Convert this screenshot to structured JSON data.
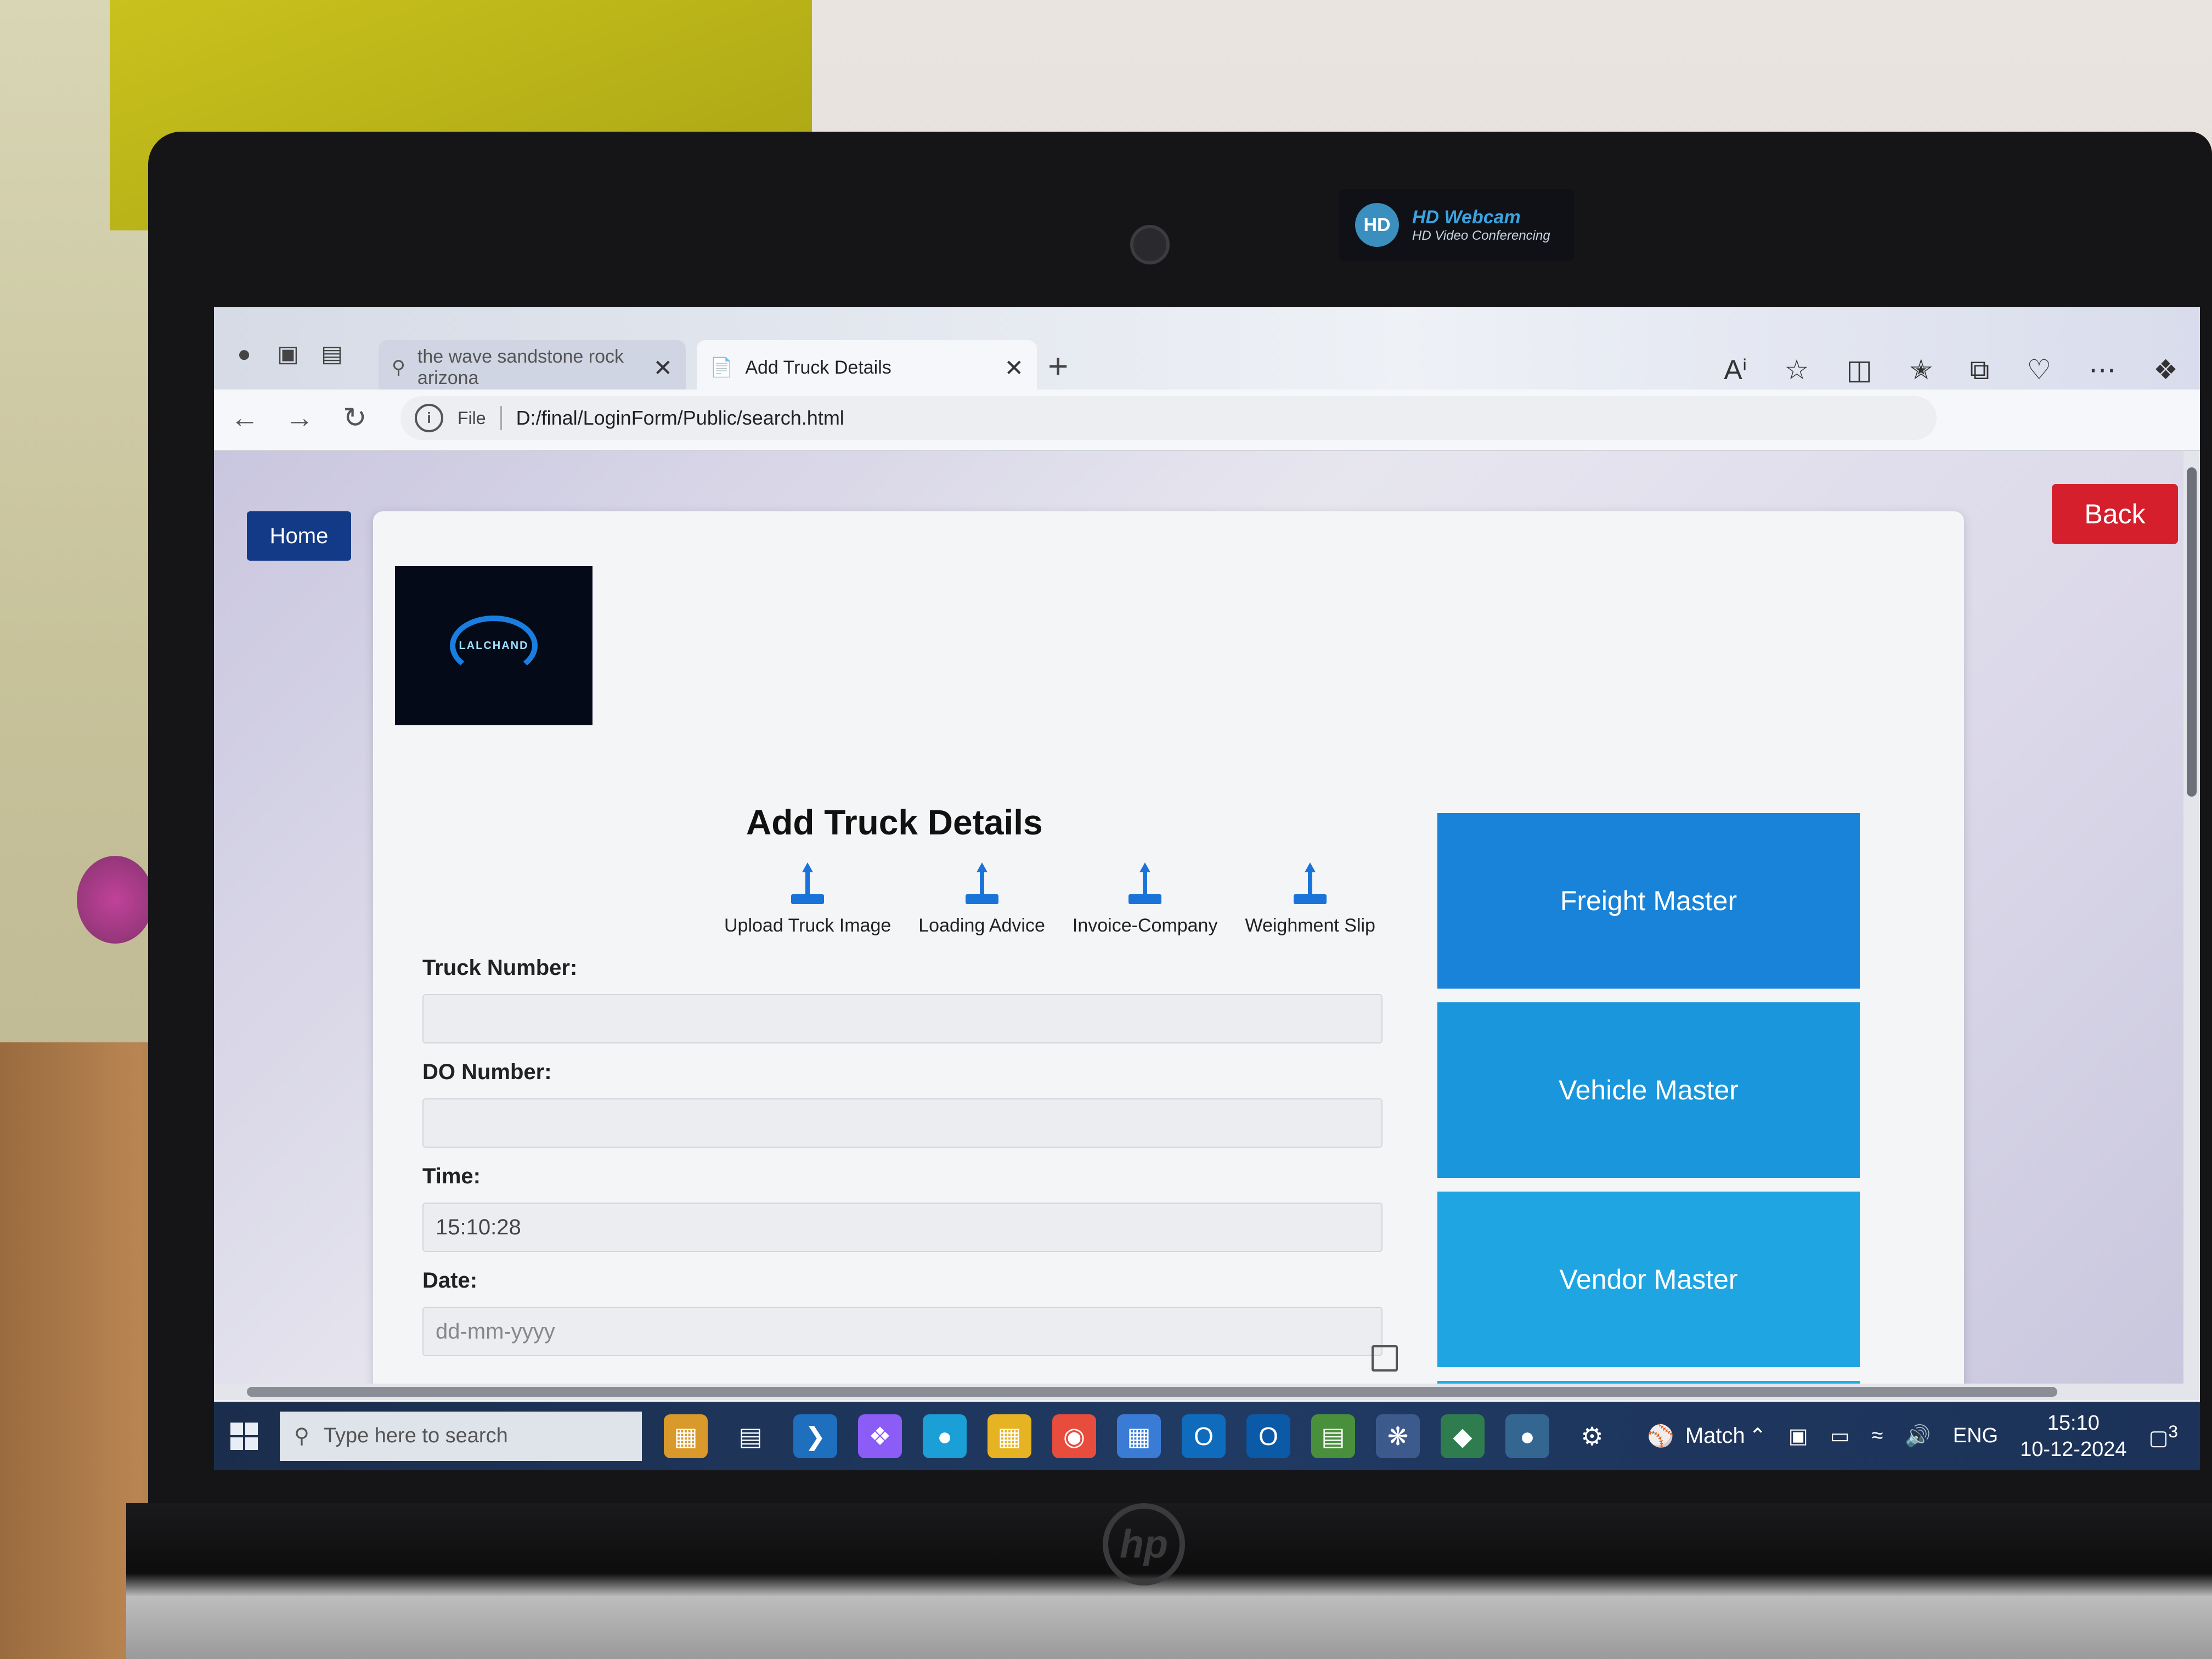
{
  "webcam": {
    "title": "HD Webcam",
    "subtitle": "HD Video Conferencing",
    "badge": "HD"
  },
  "brand": {
    "laptop_logo": "hp"
  },
  "browser": {
    "tabs": [
      {
        "label": "the wave sandstone rock arizona",
        "active": false
      },
      {
        "label": "Add Truck Details",
        "active": true
      }
    ],
    "address": {
      "scheme_label": "File",
      "url": "D:/final/LoginForm/Public/search.html"
    }
  },
  "page": {
    "home_label": "Home",
    "back_label": "Back",
    "logo_text": "LALCHAND",
    "form_title": "Add Truck Details",
    "uploads": [
      "Upload Truck Image",
      "Loading Advice",
      "Invoice-Company",
      "Weighment Slip"
    ],
    "fields": {
      "truck_number": {
        "label": "Truck Number:",
        "value": ""
      },
      "do_number": {
        "label": "DO Number:",
        "value": ""
      },
      "time": {
        "label": "Time:",
        "value": "15:10:28"
      },
      "date": {
        "label": "Date:",
        "placeholder": "dd-mm-yyyy"
      }
    },
    "side_buttons": [
      "Freight Master",
      "Vehicle Master",
      "Vendor Master"
    ],
    "side_button_colors": [
      "#1883d8",
      "#1a96dc",
      "#1fa6e2",
      "#22ace6"
    ]
  },
  "taskbar": {
    "search_placeholder": "Type here to search",
    "weather_text": "Match",
    "language": "ENG",
    "time": "15:10",
    "date": "10-12-2024",
    "notification_count": "3"
  },
  "colors": {
    "home_bg": "#123a86",
    "back_bg": "#d51f2c",
    "accent": "#1a73d9"
  }
}
